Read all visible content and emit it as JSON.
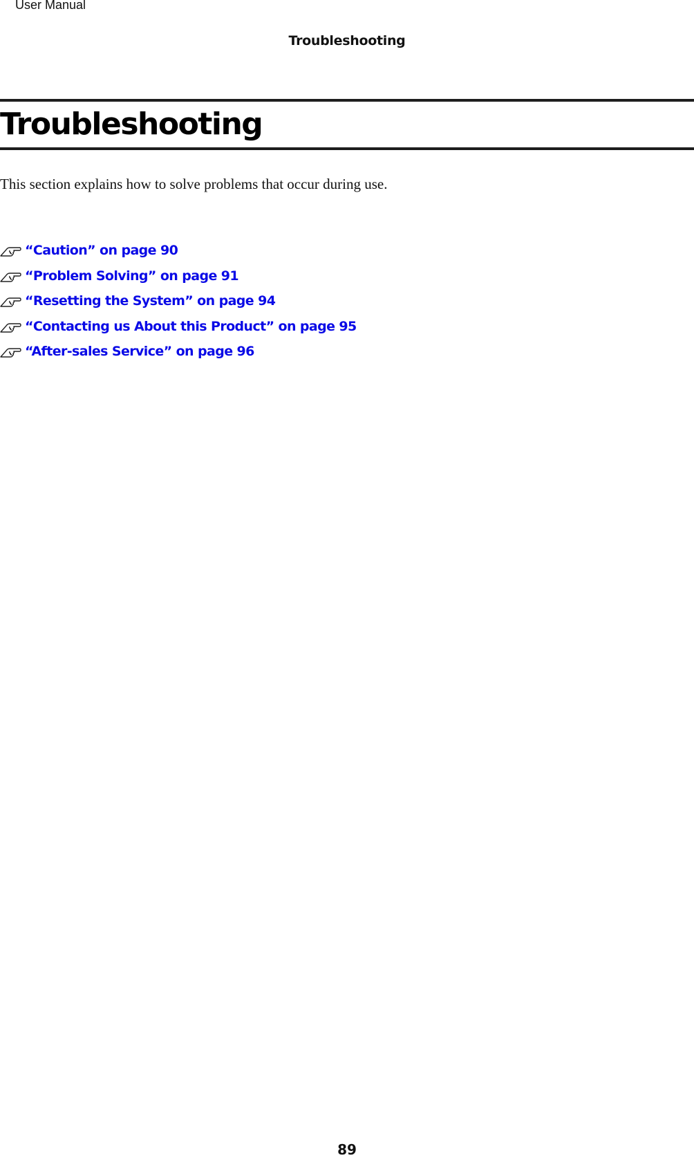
{
  "header": {
    "document_name": "User Manual",
    "section_name": "Troubleshooting"
  },
  "chapter": {
    "title": "Troubleshooting",
    "intro": "This section explains how to solve problems that occur during use."
  },
  "links": [
    {
      "icon": "pointing-hand-icon",
      "label": "“Caution” on page 90"
    },
    {
      "icon": "pointing-hand-icon",
      "label": "“Problem Solving” on page 91"
    },
    {
      "icon": "pointing-hand-icon",
      "label": "“Resetting the System” on page 94"
    },
    {
      "icon": "pointing-hand-icon",
      "label": "“Contacting us About this Product” on page 95"
    },
    {
      "icon": "pointing-hand-icon",
      "label": "“After-sales Service” on page 96"
    }
  ],
  "colors": {
    "link": "#0a0ae6",
    "text": "#111111"
  },
  "footer": {
    "page_number": "89"
  }
}
